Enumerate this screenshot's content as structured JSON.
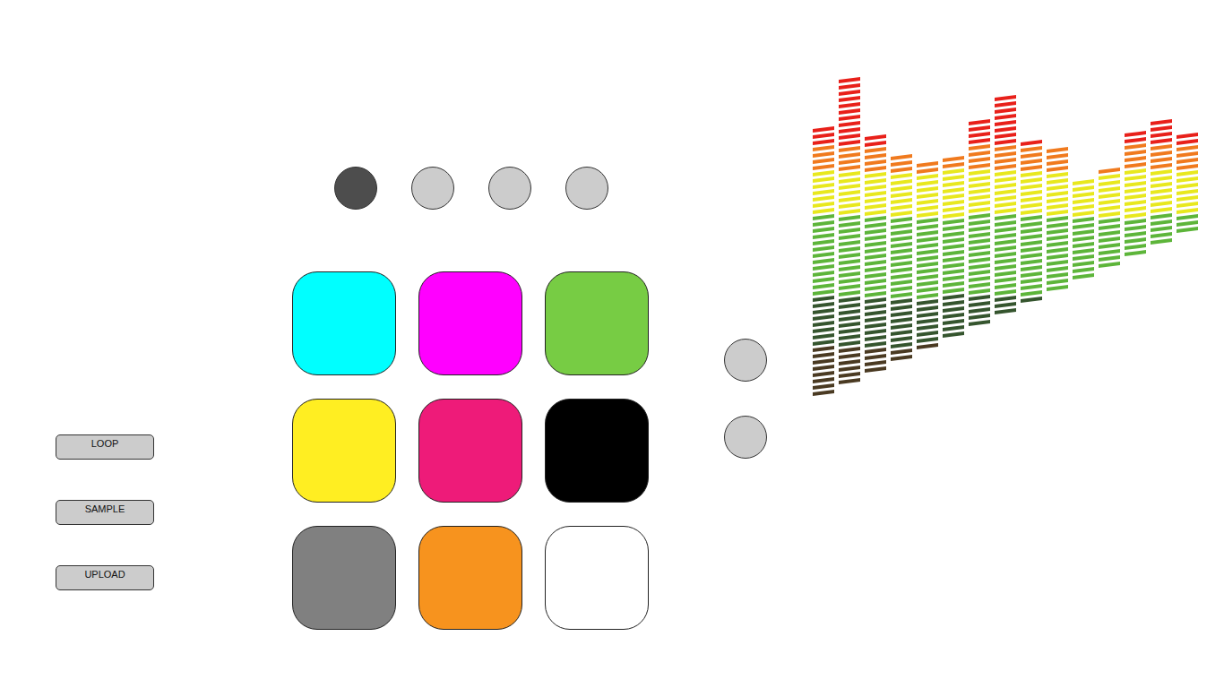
{
  "mode_buttons": [
    "LOOP",
    "SAMPLE",
    "UPLOAD"
  ],
  "bank_selectors": [
    {
      "selected": true
    },
    {
      "selected": false
    },
    {
      "selected": false
    },
    {
      "selected": false
    }
  ],
  "pads": [
    {
      "color": "#00ffff"
    },
    {
      "color": "#ff00ff"
    },
    {
      "color": "#77cc44"
    },
    {
      "color": "#ffee22"
    },
    {
      "color": "#ee1b79"
    },
    {
      "color": "#000000"
    },
    {
      "color": "#808080"
    },
    {
      "color": "#f7931e"
    },
    {
      "color": "#ffffff"
    }
  ],
  "side_buttons": [
    {
      "selected": false
    },
    {
      "selected": false
    }
  ],
  "equalizer": {
    "levels": [
      43,
      49,
      38,
      33,
      30,
      29,
      33,
      35,
      26,
      23,
      16,
      16,
      20,
      20,
      16
    ]
  }
}
